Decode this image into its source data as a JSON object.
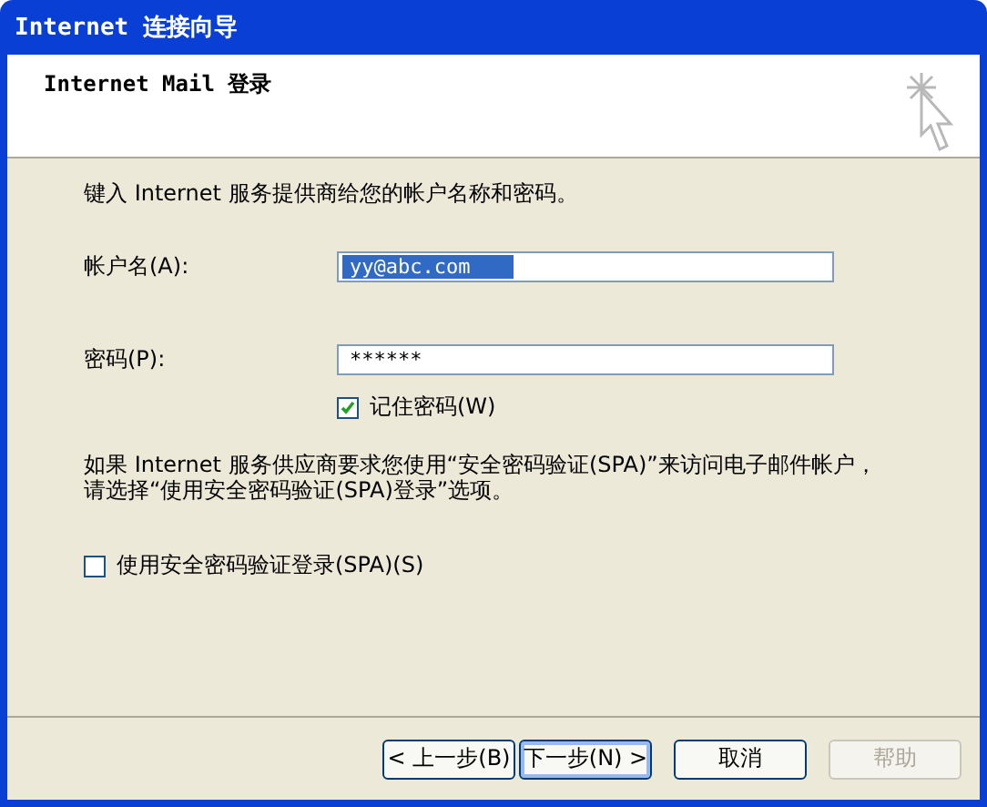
{
  "window": {
    "title": "Internet 连接向导"
  },
  "header": {
    "title": "Internet Mail 登录"
  },
  "intro": "键入 Internet 服务提供商给您的帐户名称和密码。",
  "fields": [
    {
      "label": "帐户名(A):",
      "value": "yy@abc.com",
      "selected": true
    },
    {
      "label": "密码(P):",
      "value": "******",
      "selected": false
    }
  ],
  "remember": {
    "label": "记住密码(W)",
    "checked": true
  },
  "note": "如果 Internet 服务供应商要求您使用“安全密码验证(SPA)”来访问电子邮件帐户，请选择“使用安全密码验证(SPA)登录”选项。",
  "spa": {
    "label": "使用安全密码验证登录(SPA)(S)",
    "checked": false
  },
  "buttons": [
    {
      "label": "< 上一步(B)",
      "disabled": false,
      "focused": false
    },
    {
      "label": "下一步(N) >",
      "disabled": false,
      "focused": true
    },
    {
      "label": "取消",
      "disabled": false,
      "focused": false
    },
    {
      "label": "帮助",
      "disabled": true,
      "focused": false
    }
  ]
}
